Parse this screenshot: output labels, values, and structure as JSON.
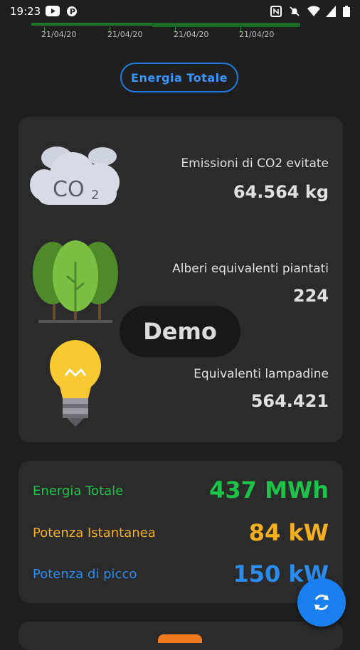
{
  "status_bar": {
    "time": "19:23"
  },
  "chart_strip": {
    "dates": [
      "21/04/20",
      "21/04/20",
      "21/04/20",
      "21/04/20"
    ]
  },
  "mode_button": {
    "label": "Energia Totale"
  },
  "environment": {
    "co2": {
      "icon": "co2-cloud-icon",
      "label": "Emissioni di CO2 evitate",
      "value": "64.564 kg"
    },
    "trees": {
      "icon": "trees-icon",
      "label": "Alberi equivalenti piantati",
      "value": "224"
    },
    "bulbs": {
      "icon": "lightbulb-icon",
      "label": "Equivalenti lampadine",
      "value": "564.421"
    }
  },
  "overlay": {
    "demo_label": "Demo"
  },
  "energy": {
    "total": {
      "label": "Energia Totale",
      "value": "437 MWh",
      "color": "#1ec24a"
    },
    "instant": {
      "label": "Potenza Istantanea",
      "value": "84 kW",
      "color": "#f2b01e"
    },
    "peak": {
      "label": "Potenza di picco",
      "value": "150 kW",
      "color": "#2a8cf0"
    }
  },
  "fab": {
    "icon": "refresh-icon"
  }
}
